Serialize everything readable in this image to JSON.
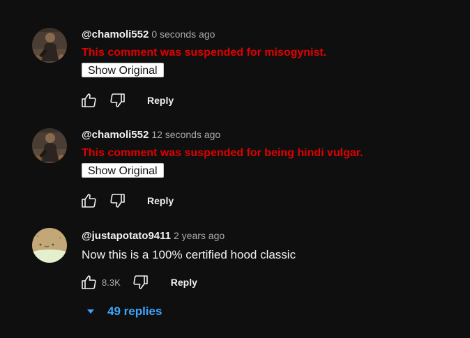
{
  "comments": [
    {
      "author": "@chamoli552",
      "time": "0 seconds ago",
      "avatar_icon": "user-photo-icon",
      "suspended_message": "This comment was suspended for misogynist.",
      "show_original_label": "Show Original",
      "reply_label": "Reply"
    },
    {
      "author": "@chamoli552",
      "time": "12 seconds ago",
      "avatar_icon": "user-photo-icon",
      "suspended_message": "This comment was suspended for being hindi vulgar.",
      "show_original_label": "Show Original",
      "reply_label": "Reply"
    },
    {
      "author": "@justapotato9411",
      "time": "2 years ago",
      "avatar_icon": "potato-avatar-icon",
      "text": "Now this is a 100% certified hood classic",
      "likes": "8.3K",
      "reply_label": "Reply",
      "replies_label": "49 replies"
    }
  ],
  "colors": {
    "background": "#0f0f0f",
    "suspended_text": "#e00000",
    "link_blue": "#3ea6ff",
    "secondary_text": "#aaaaaa"
  }
}
